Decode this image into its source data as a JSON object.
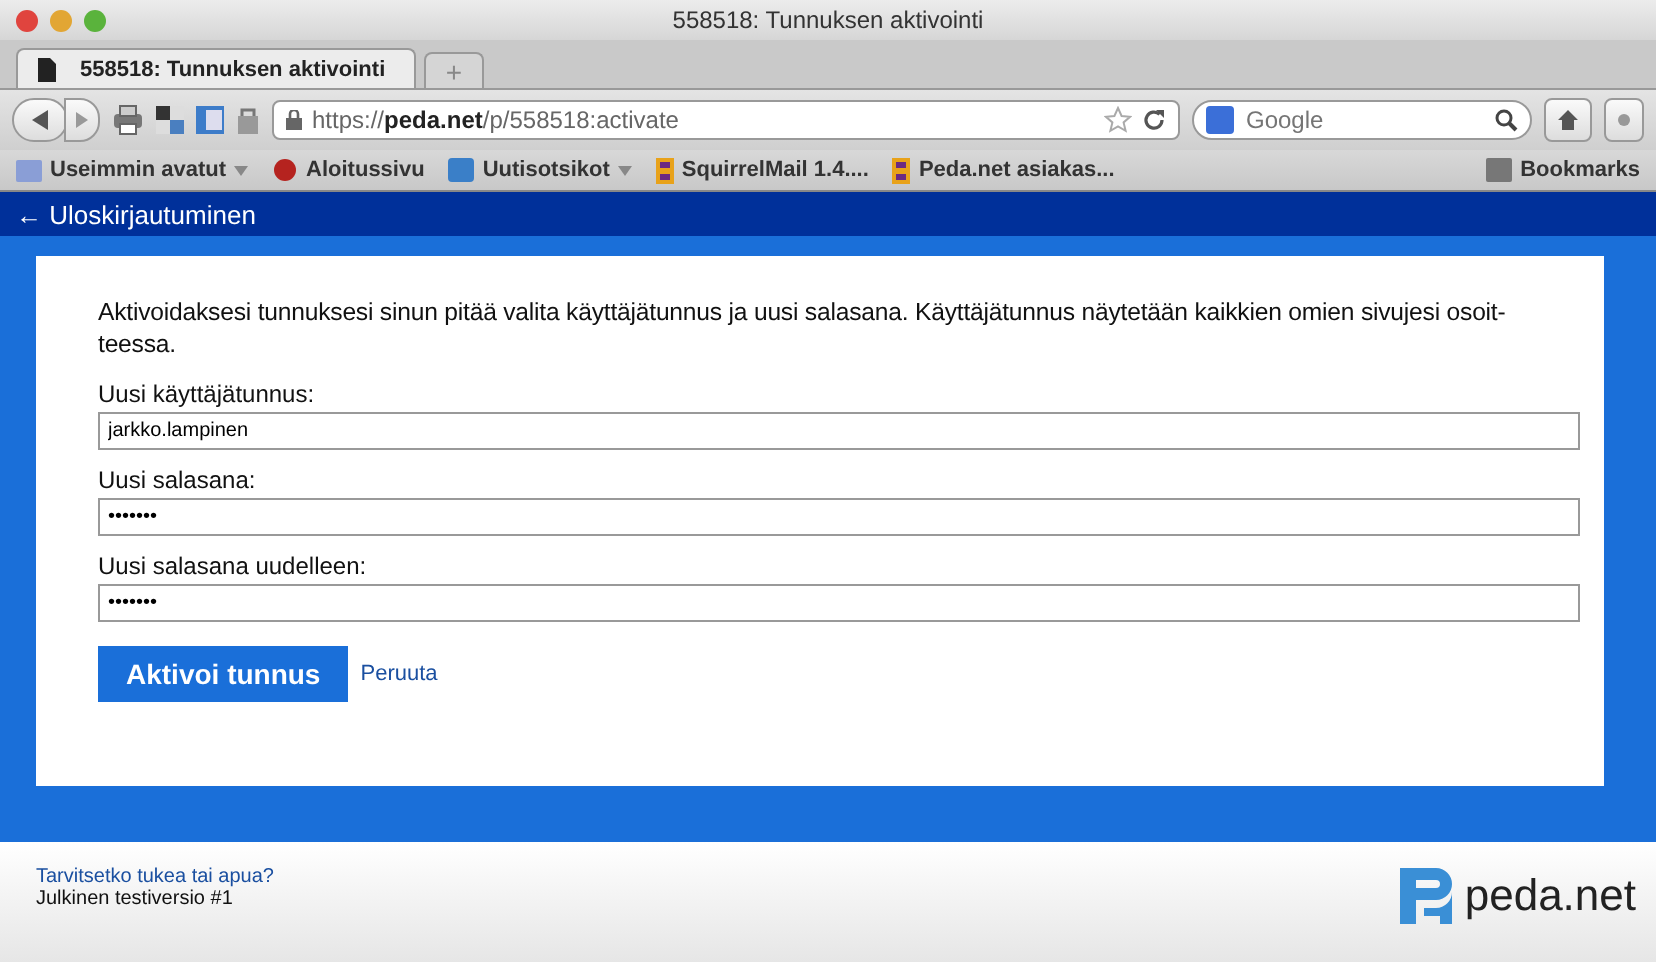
{
  "window": {
    "title": "558518: Tunnuksen aktivointi"
  },
  "tabs": [
    {
      "label": "558518: Tunnuksen aktivointi",
      "selected": true
    }
  ],
  "new_tab": "+",
  "url": "https://**peda.net**/p/558518:activate",
  "search": {
    "placeholder": "Google"
  },
  "bookmarks": [
    {
      "label": "Useimmin avatut",
      "kind": "folder",
      "dropdown": true
    },
    {
      "label": "Aloitussivu",
      "kind": "site",
      "dropdown": false
    },
    {
      "label": "Uutisotsikot",
      "kind": "feed",
      "dropdown": true
    },
    {
      "label": "SquirrelMail 1.4....",
      "kind": "mail",
      "dropdown": false
    },
    {
      "label": "Peda.net asiakas...",
      "kind": "mail",
      "dropdown": false
    }
  ],
  "bookmarks_menu": "Bookmarks",
  "topbar": {
    "logout": "← Uloskirjautuminen"
  },
  "form": {
    "intro": "Aktivoidaksesi tunnuksesi sinun pitää valita käyttäjätunnus ja uusi salasana. Käyttäjätunnus näytetään kaikkien omien sivujesi osoit-teessa.",
    "fields": [
      {
        "label": "Uusi käyttäjätunnus:",
        "value": "jarkko.lampinen"
      },
      {
        "label": "Uusi salasana:",
        "value": "•••••••"
      },
      {
        "label": "Uusi salasana uudelleen:",
        "value": "•••••••"
      }
    ],
    "submit": "Aktivoi tunnus",
    "cancel": "Peruuta"
  },
  "footer": {
    "help_link": "Tarvitsetko tukea tai apua?",
    "version": "Julkinen testiversio #1",
    "logo": "peda.net"
  }
}
